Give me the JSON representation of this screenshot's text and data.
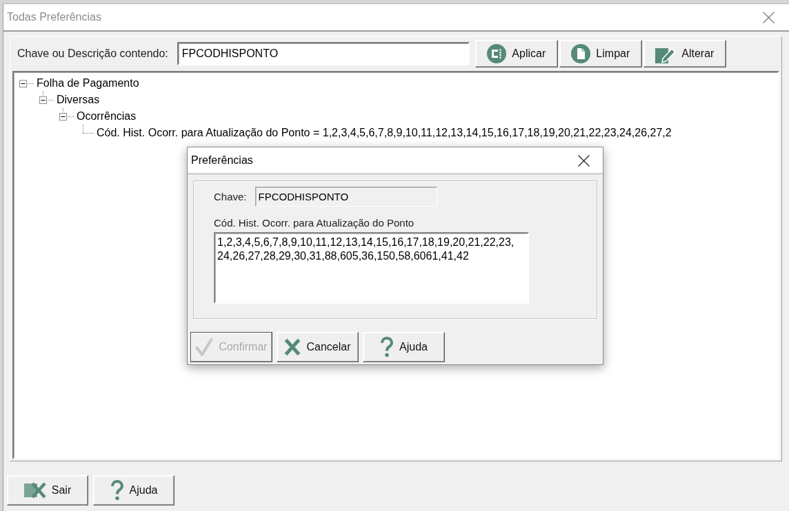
{
  "window": {
    "title": "Todas Preferências",
    "active": false
  },
  "search": {
    "label": "Chave ou Descrição contendo:",
    "value": "FPCODHISPONTO"
  },
  "toolbar_buttons": [
    {
      "kind": "apply",
      "label": "Aplicar"
    },
    {
      "kind": "clear",
      "label": "Limpar"
    },
    {
      "kind": "edit",
      "label": "Alterar"
    }
  ],
  "tree": [
    {
      "label": "Folha de Pagamento",
      "expanded": true,
      "children": [
        {
          "label": "Diversas",
          "expanded": true,
          "children": [
            {
              "label": "Ocorrências",
              "expanded": true,
              "children": [
                {
                  "label": "Cód. Hist. Ocorr. para Atualização do Ponto = 1,2,3,4,5,6,7,8,9,10,11,12,13,14,15,16,17,18,19,20,21,22,23,24,26,27,2"
                }
              ]
            }
          ]
        }
      ]
    }
  ],
  "bottom_buttons": [
    {
      "kind": "exit",
      "label": "Sair"
    },
    {
      "kind": "help",
      "label": "Ajuda"
    }
  ],
  "dialog": {
    "title": "Preferências",
    "active": true,
    "key_label": "Chave:",
    "key_value": "FPCODHISPONTO",
    "value_label": "Cód. Hist. Ocorr. para Atualização do Ponto",
    "value": "1,2,3,4,5,6,7,8,9,10,11,12,13,14,15,16,17,18,19,20,21,22,23,24,26,27,28,29,30,31,88,605,36,150,58,6061,41,42",
    "buttons": [
      {
        "kind": "confirm",
        "label": "Confirmar",
        "disabled": true
      },
      {
        "kind": "cancel",
        "label": "Cancelar",
        "disabled": false
      },
      {
        "kind": "help",
        "label": "Ajuda",
        "disabled": false
      }
    ]
  }
}
